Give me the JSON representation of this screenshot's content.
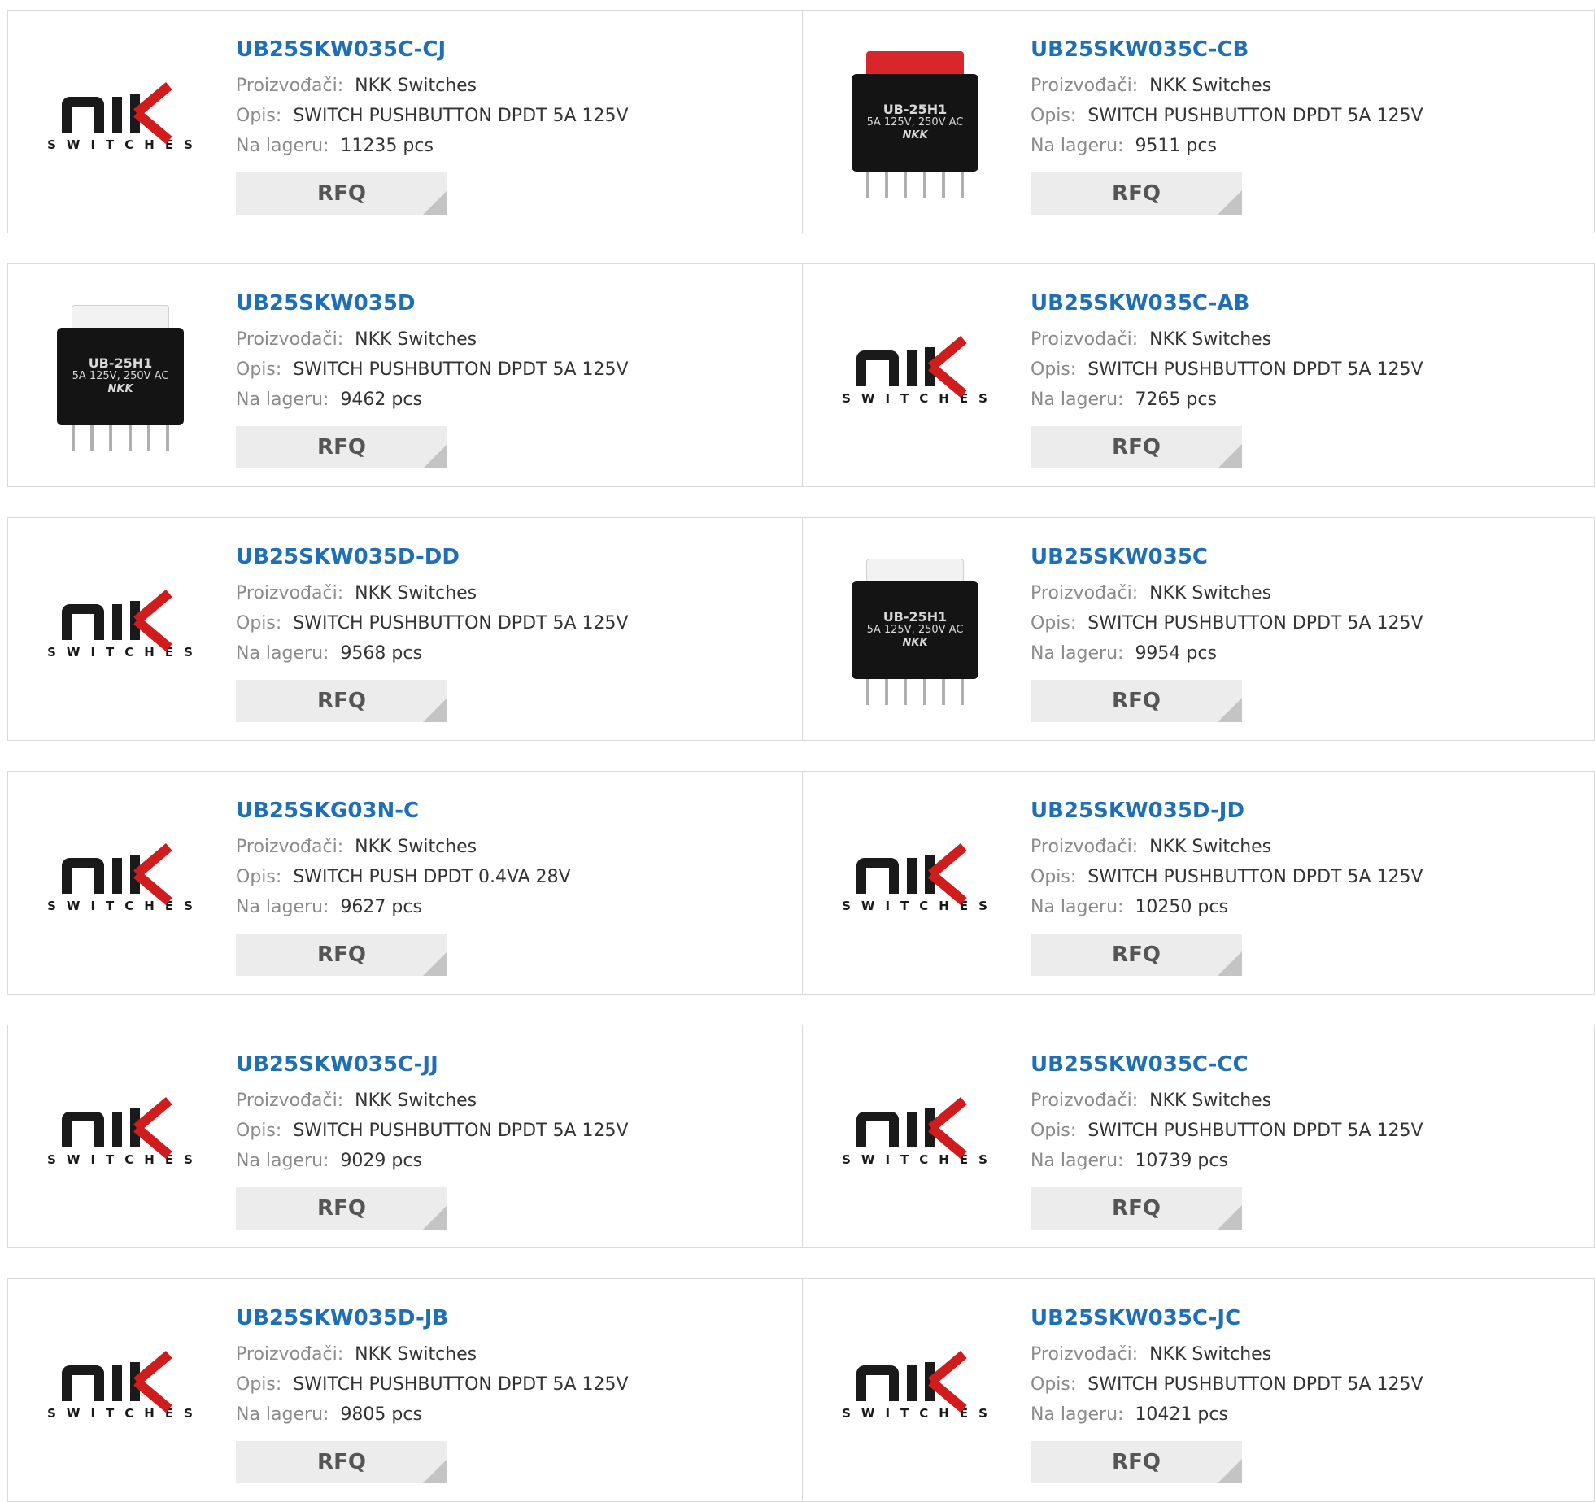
{
  "labels": {
    "manufacturer": "Proizvođači:",
    "description": "Opis:",
    "stock": "Na lageru:",
    "rfq": "RFQ"
  },
  "logo": {
    "brand": "NKK",
    "word": "SWITCHES"
  },
  "photo_text": {
    "model": "UB-25H1",
    "rating": "5A 125V, 250V AC",
    "brand": "NKK"
  },
  "colors": {
    "title": "#1f6fb4",
    "label": "#8a8a8a",
    "cap_red": "#d8262b",
    "cap_white": "#f2f2f2"
  },
  "products": [
    {
      "part": "UB25SKW035C-CJ",
      "manufacturer": "NKK Switches",
      "description": "SWITCH PUSHBUTTON DPDT 5A 125V",
      "stock": "11235 pcs",
      "image": "nkk-logo"
    },
    {
      "part": "UB25SKW035C-CB",
      "manufacturer": "NKK Switches",
      "description": "SWITCH PUSHBUTTON DPDT 5A 125V",
      "stock": "9511 pcs",
      "image": "switch-red"
    },
    {
      "part": "UB25SKW035D",
      "manufacturer": "NKK Switches",
      "description": "SWITCH PUSHBUTTON DPDT 5A 125V",
      "stock": "9462 pcs",
      "image": "switch-white"
    },
    {
      "part": "UB25SKW035C-AB",
      "manufacturer": "NKK Switches",
      "description": "SWITCH PUSHBUTTON DPDT 5A 125V",
      "stock": "7265 pcs",
      "image": "nkk-logo"
    },
    {
      "part": "UB25SKW035D-DD",
      "manufacturer": "NKK Switches",
      "description": "SWITCH PUSHBUTTON DPDT 5A 125V",
      "stock": "9568 pcs",
      "image": "nkk-logo"
    },
    {
      "part": "UB25SKW035C",
      "manufacturer": "NKK Switches",
      "description": "SWITCH PUSHBUTTON DPDT 5A 125V",
      "stock": "9954 pcs",
      "image": "switch-white"
    },
    {
      "part": "UB25SKG03N-C",
      "manufacturer": "NKK Switches",
      "description": "SWITCH PUSH DPDT 0.4VA 28V",
      "stock": "9627 pcs",
      "image": "nkk-logo"
    },
    {
      "part": "UB25SKW035D-JD",
      "manufacturer": "NKK Switches",
      "description": "SWITCH PUSHBUTTON DPDT 5A 125V",
      "stock": "10250 pcs",
      "image": "nkk-logo"
    },
    {
      "part": "UB25SKW035C-JJ",
      "manufacturer": "NKK Switches",
      "description": "SWITCH PUSHBUTTON DPDT 5A 125V",
      "stock": "9029 pcs",
      "image": "nkk-logo"
    },
    {
      "part": "UB25SKW035C-CC",
      "manufacturer": "NKK Switches",
      "description": "SWITCH PUSHBUTTON DPDT 5A 125V",
      "stock": "10739 pcs",
      "image": "nkk-logo"
    },
    {
      "part": "UB25SKW035D-JB",
      "manufacturer": "NKK Switches",
      "description": "SWITCH PUSHBUTTON DPDT 5A 125V",
      "stock": "9805 pcs",
      "image": "nkk-logo"
    },
    {
      "part": "UB25SKW035C-JC",
      "manufacturer": "NKK Switches",
      "description": "SWITCH PUSHBUTTON DPDT 5A 125V",
      "stock": "10421 pcs",
      "image": "nkk-logo"
    }
  ]
}
